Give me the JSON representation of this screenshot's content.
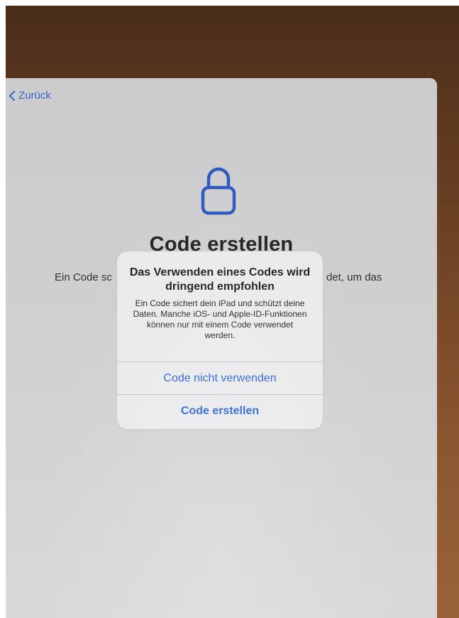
{
  "nav": {
    "back_label": "Zurück"
  },
  "setup": {
    "title": "Code erstellen",
    "description_visible_left": "Ein Code sc",
    "description_visible_right": "det, um das",
    "lock_icon": "lock-icon"
  },
  "alert": {
    "title": "Das Verwenden eines Codes wird dringend empfohlen",
    "message": "Ein Code sichert dein iPad und schützt deine Daten. Manche iOS- und Apple-ID-Funktionen können nur mit einem Code verwendet werden.",
    "secondary_button_label": "Code nicht verwenden",
    "primary_button_label": "Code erstellen"
  },
  "colors": {
    "accent": "#2a63d1",
    "lock_outline": "#2e5fc9"
  }
}
